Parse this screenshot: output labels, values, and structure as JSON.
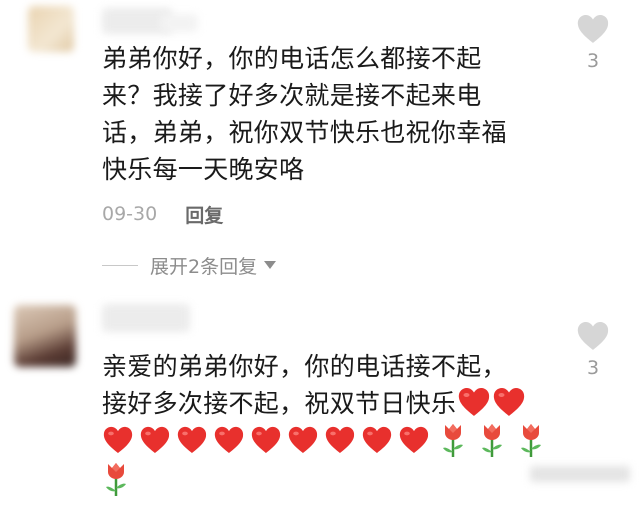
{
  "comments": [
    {
      "text_lines": [
        "弟弟你好，你的电话怎么都接不起",
        "来？我接了好多次就是接不起来电",
        "话，弟弟，祝你双节快乐也祝你幸福",
        "快乐每一天晚安咯"
      ],
      "like_count": "3",
      "date": "09-30",
      "reply_label": "回复",
      "expand_label": "展开2条回复"
    },
    {
      "text_lines": [
        "亲爱的弟弟你好，你的电话接不起，",
        "接好多次接不起，祝双节日快乐"
      ],
      "like_count": "3",
      "emoji_rows": [
        [
          "heart",
          "heart",
          "heart",
          "heart",
          "heart",
          "heart",
          "heart",
          "heart",
          "heart",
          "tulip",
          "tulip",
          "tulip"
        ],
        [
          "tulip"
        ]
      ],
      "inline_emojis": [
        "heart",
        "heart"
      ]
    }
  ],
  "colors": {
    "heart": "#e8302d",
    "tulip": "#e84a3c",
    "like_icon": "#d6d6d6"
  }
}
